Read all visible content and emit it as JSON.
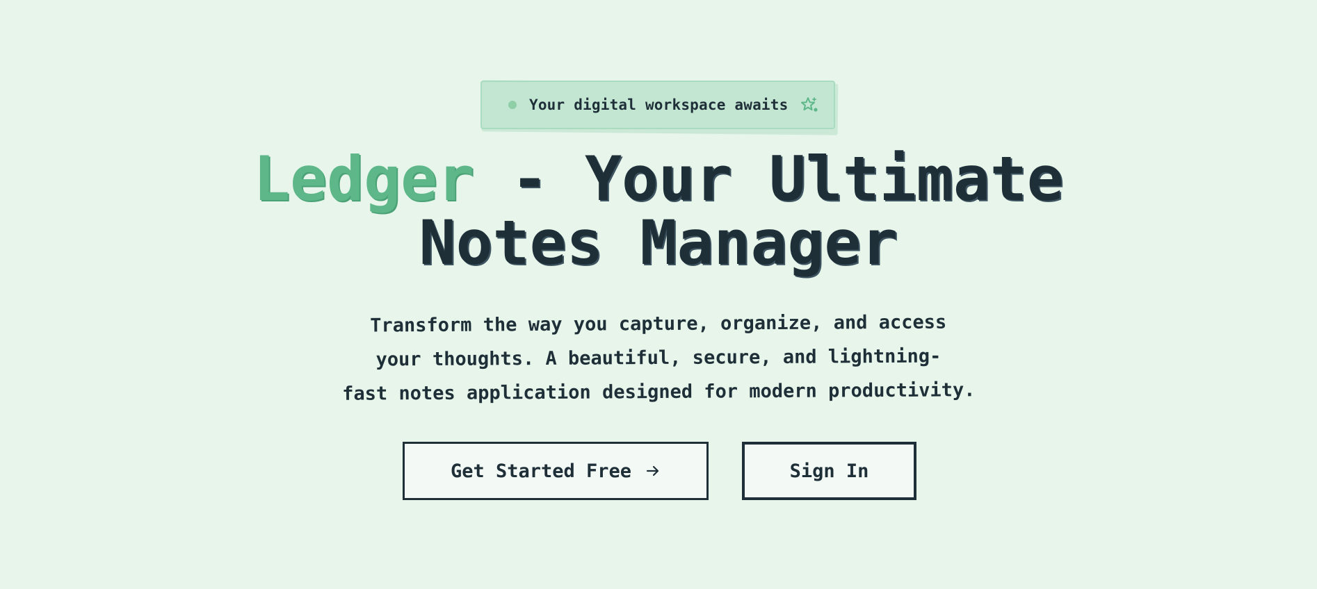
{
  "badge": {
    "text": "Your digital workspace awaits",
    "dot_icon": "dot-icon",
    "sparkle_icon": "sparkle-star-icon"
  },
  "title": {
    "brand": "Ledger",
    "rest_line1": " - Your Ultimate",
    "line2": "Notes Manager"
  },
  "description": {
    "line1": "Transform the way you capture, organize, and access",
    "line2": "your thoughts. A beautiful, secure, and lightning-",
    "line3": "fast notes application designed for modern productivity."
  },
  "buttons": {
    "primary_label": "Get Started Free",
    "primary_icon": "arrow-right-icon",
    "secondary_label": "Sign In"
  },
  "colors": {
    "background": "#e7f5eb",
    "brand": "#5db789",
    "text": "#1f2f38",
    "badge_bg": "#c3e6d2",
    "button_bg": "#f3faf5"
  }
}
